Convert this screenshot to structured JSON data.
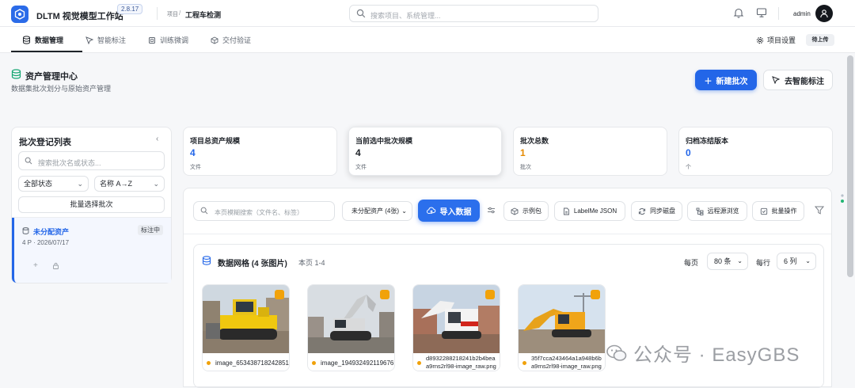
{
  "app": {
    "title": "DLTM 视觉模型工作站",
    "version": "2.8.17"
  },
  "breadcrumb": {
    "label": "项目",
    "slash": "/",
    "project": "工程车检测"
  },
  "search": {
    "placeholder": "搜索项目、系统管理..."
  },
  "user": {
    "name": "admin"
  },
  "tabs": [
    {
      "label": "数据管理",
      "icon": "database-icon",
      "active": true
    },
    {
      "label": "智能标注",
      "icon": "cursor-icon"
    },
    {
      "label": "训练微调",
      "icon": "cpu-icon"
    },
    {
      "label": "交付验证",
      "icon": "cube-icon"
    }
  ],
  "header_right": {
    "settings": "项目设置",
    "badge": "待上传"
  },
  "page": {
    "title": "资产管理中心",
    "subtitle": "数据集批次划分与原始资产管理",
    "new_batch": "新建批次",
    "go_label": "去智能标注"
  },
  "sidebar": {
    "title": "批次登记列表",
    "collapse": "‹",
    "search_placeholder": "搜索批次名或状态...",
    "status_filter": "全部状态",
    "sort": "名称 A→Z",
    "batch_select": "批量选择批次",
    "batches": [
      {
        "name": "未分配资产",
        "tag": "标注中",
        "meta": "4 P · 2026/07/17"
      }
    ]
  },
  "stats": [
    {
      "label": "项目总资产规模",
      "value": "4",
      "unit": "文件",
      "color": "#2366e8"
    },
    {
      "label": "当前选中批次规模",
      "value": "4",
      "unit": "文件",
      "color": "#1f2329"
    },
    {
      "label": "批次总数",
      "value": "1",
      "unit": "批次",
      "color": "#e58a00"
    },
    {
      "label": "归档冻结版本",
      "value": "0",
      "unit": "个",
      "color": "#2366e8"
    }
  ],
  "toolbar": {
    "search_placeholder": "本页模糊搜索（文件名、标签）",
    "filter_select": "未分配资产 (4张)",
    "import": "导入数据",
    "buttons": [
      "示例包",
      "LabelMe JSON",
      "同步磁盘",
      "远程源浏览",
      "批量操作"
    ]
  },
  "grid": {
    "title": "数据网格 (4 张图片)",
    "range": "本页 1-4",
    "per_page_label": "每页",
    "per_page": "80 条",
    "per_row_label": "每行",
    "per_row": "6 列",
    "items": [
      {
        "line1": "image_653438718242851...",
        "line2": ""
      },
      {
        "line1": "image_194932492119676...",
        "line2": ""
      },
      {
        "line1": "d8932288218241b2b4bea",
        "line2": "a9rns2rl98-image_raw.png"
      },
      {
        "line1": "35f7cca243464a1a948b6b",
        "line2": "a9rns2rl98-image_raw.png"
      }
    ]
  },
  "watermark": {
    "text": "公众号 · EasyGBS"
  }
}
